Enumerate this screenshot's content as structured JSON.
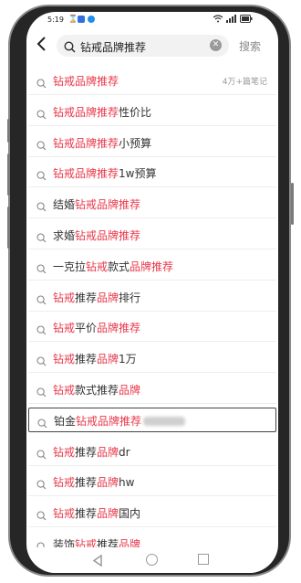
{
  "status_bar": {
    "time": "5:19"
  },
  "search": {
    "query": "钻戒品牌推荐",
    "submit_label": "搜索"
  },
  "colors": {
    "highlight": "#e8394b"
  },
  "suggestions": [
    {
      "segments": [
        {
          "t": "钻戒品牌推荐",
          "h": true
        }
      ],
      "count": "4万+篇笔记"
    },
    {
      "segments": [
        {
          "t": "钻戒品牌推荐",
          "h": true
        },
        {
          "t": "性价比",
          "h": false
        }
      ]
    },
    {
      "segments": [
        {
          "t": "钻戒品牌推荐",
          "h": true
        },
        {
          "t": "小预算",
          "h": false
        }
      ]
    },
    {
      "segments": [
        {
          "t": "钻戒品牌推荐",
          "h": true
        },
        {
          "t": "1w预算",
          "h": false
        }
      ]
    },
    {
      "segments": [
        {
          "t": "结婚",
          "h": false
        },
        {
          "t": "钻戒品牌推荐",
          "h": true
        }
      ]
    },
    {
      "segments": [
        {
          "t": "求婚",
          "h": false
        },
        {
          "t": "钻戒品牌推荐",
          "h": true
        }
      ]
    },
    {
      "segments": [
        {
          "t": "一克拉",
          "h": false
        },
        {
          "t": "钻戒",
          "h": true
        },
        {
          "t": "款式",
          "h": false
        },
        {
          "t": "品牌推荐",
          "h": true
        }
      ]
    },
    {
      "segments": [
        {
          "t": "钻戒",
          "h": true
        },
        {
          "t": "推荐",
          "h": false
        },
        {
          "t": "品牌",
          "h": true
        },
        {
          "t": "排行",
          "h": false
        }
      ]
    },
    {
      "segments": [
        {
          "t": "钻戒",
          "h": true
        },
        {
          "t": "平价",
          "h": false
        },
        {
          "t": "品牌推荐",
          "h": true
        }
      ]
    },
    {
      "segments": [
        {
          "t": "钻戒",
          "h": true
        },
        {
          "t": "推荐",
          "h": false
        },
        {
          "t": "品牌",
          "h": true
        },
        {
          "t": "1万",
          "h": false
        }
      ]
    },
    {
      "segments": [
        {
          "t": "钻戒",
          "h": true
        },
        {
          "t": "款式推荐",
          "h": false
        },
        {
          "t": "品牌",
          "h": true
        }
      ]
    },
    {
      "segments": [
        {
          "t": "铂金",
          "h": false
        },
        {
          "t": "钻戒品牌推荐",
          "h": true
        }
      ],
      "selected": true,
      "obscured_suffix": true
    },
    {
      "segments": [
        {
          "t": "钻戒",
          "h": true
        },
        {
          "t": "推荐",
          "h": false
        },
        {
          "t": "品牌",
          "h": true
        },
        {
          "t": "dr",
          "h": false
        }
      ]
    },
    {
      "segments": [
        {
          "t": "钻戒",
          "h": true
        },
        {
          "t": "推荐",
          "h": false
        },
        {
          "t": "品牌",
          "h": true
        },
        {
          "t": "hw",
          "h": false
        }
      ]
    },
    {
      "segments": [
        {
          "t": "钻戒",
          "h": true
        },
        {
          "t": "推荐",
          "h": false
        },
        {
          "t": "品牌",
          "h": true
        },
        {
          "t": "国内",
          "h": false
        }
      ]
    },
    {
      "segments": [
        {
          "t": "装饰",
          "h": false
        },
        {
          "t": "钻戒",
          "h": true
        },
        {
          "t": "推荐",
          "h": false
        },
        {
          "t": "品牌",
          "h": true
        }
      ]
    }
  ]
}
